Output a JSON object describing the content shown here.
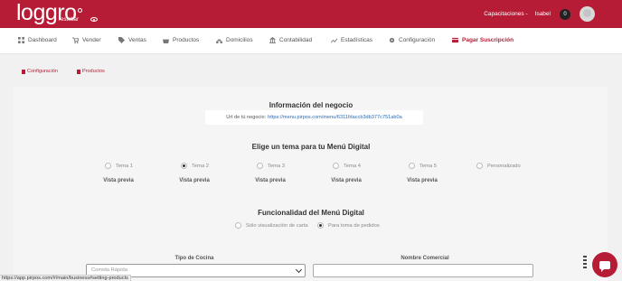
{
  "brand": {
    "name": "loggro",
    "sub": "restobar"
  },
  "top": {
    "capacitaciones": "Capacitaciones -",
    "user": "Isabel",
    "badge": "0"
  },
  "nav": [
    {
      "label": "Dashboard",
      "icon": "grid-icon"
    },
    {
      "label": "Vender",
      "icon": "cart-icon"
    },
    {
      "label": "Ventas",
      "icon": "tag-icon"
    },
    {
      "label": "Productos",
      "icon": "basket-icon"
    },
    {
      "label": "Domicilios",
      "icon": "scooter-icon"
    },
    {
      "label": "Contabilidad",
      "icon": "bank-icon"
    },
    {
      "label": "Estadísticas",
      "icon": "trend-icon"
    },
    {
      "label": "Configuración",
      "icon": "gear-icon"
    },
    {
      "label": "Pagar Suscripción",
      "icon": "card-icon"
    }
  ],
  "subtabs": [
    {
      "label": "Configuración"
    },
    {
      "label": "Productos"
    }
  ],
  "business": {
    "title": "Información del negocio",
    "url_label": "Url de tú negocio:",
    "url": "https://menu.pirpos.com/menu/6311fdaccb3db377c751ab0a"
  },
  "theme": {
    "title": "Elige un tema para tu Menú Digital",
    "options": [
      "Tema 1",
      "Tema 2",
      "Tema 3",
      "Tema 4",
      "Tema 5",
      "Personalizado"
    ],
    "selected": "Tema 2",
    "preview": "Vista previa"
  },
  "functionality": {
    "title": "Funcionalidad del Menú Digital",
    "options": [
      "Sólo visualización de carta",
      "Para toma de pedidos"
    ],
    "selected": "Para toma de pedidos"
  },
  "form": {
    "cocina_label": "Tipo de Cocina",
    "cocina_value": "Comida Rápida",
    "comercial_label": "Nombre Comercial"
  },
  "status_url": "https://app.pirpos.com/#/main/business#setting-products",
  "colors": {
    "brand": "#b71c36"
  }
}
